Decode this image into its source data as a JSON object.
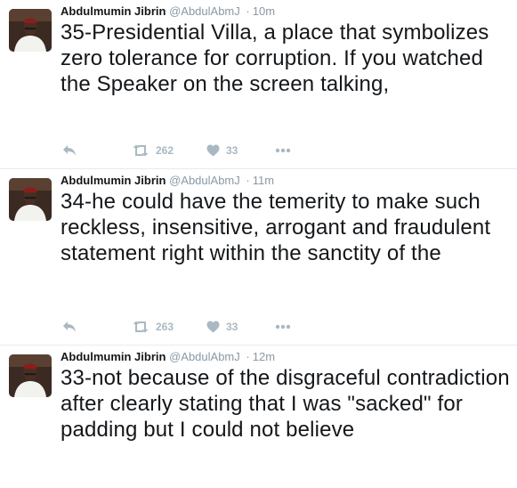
{
  "tweets": [
    {
      "fullname": "Abdulmumin Jibrin",
      "username": "@AbdulAbmJ",
      "separator": "·",
      "time": "10m",
      "text": "35-Presidential Villa, a place that symbolizes zero tolerance for corruption. If you watched the Speaker on the screen talking,",
      "retweets": "262",
      "likes": "33",
      "avatar_icon": "user-avatar",
      "reply_icon": "reply-arrow",
      "retweet_icon": "retweet-arrows",
      "like_icon": "heart",
      "more_icon": "ellipsis"
    },
    {
      "fullname": "Abdulmumin Jibrin",
      "username": "@AbdulAbmJ",
      "separator": "·",
      "time": "11m",
      "text": "34-he could have the temerity to make such reckless, insensitive, arrogant and fraudulent statement right within the sanctity of the",
      "retweets": "263",
      "likes": "33",
      "avatar_icon": "user-avatar",
      "reply_icon": "reply-arrow",
      "retweet_icon": "retweet-arrows",
      "like_icon": "heart",
      "more_icon": "ellipsis"
    },
    {
      "fullname": "Abdulmumin Jibrin",
      "username": "@AbdulAbmJ",
      "separator": "·",
      "time": "12m",
      "text": "33-not because of the disgraceful contradiction after clearly stating that I was \"sacked\" for padding but I could not believe",
      "avatar_icon": "user-avatar"
    }
  ],
  "colors": {
    "text": "#14171a",
    "meta": "#8899a6",
    "action_icon": "#aab8c2",
    "divider": "#e6ecf0",
    "avatar_background": "#3a2a22",
    "avatar_robe": "#f2f2ef",
    "avatar_cap": "#8a1d1d"
  }
}
